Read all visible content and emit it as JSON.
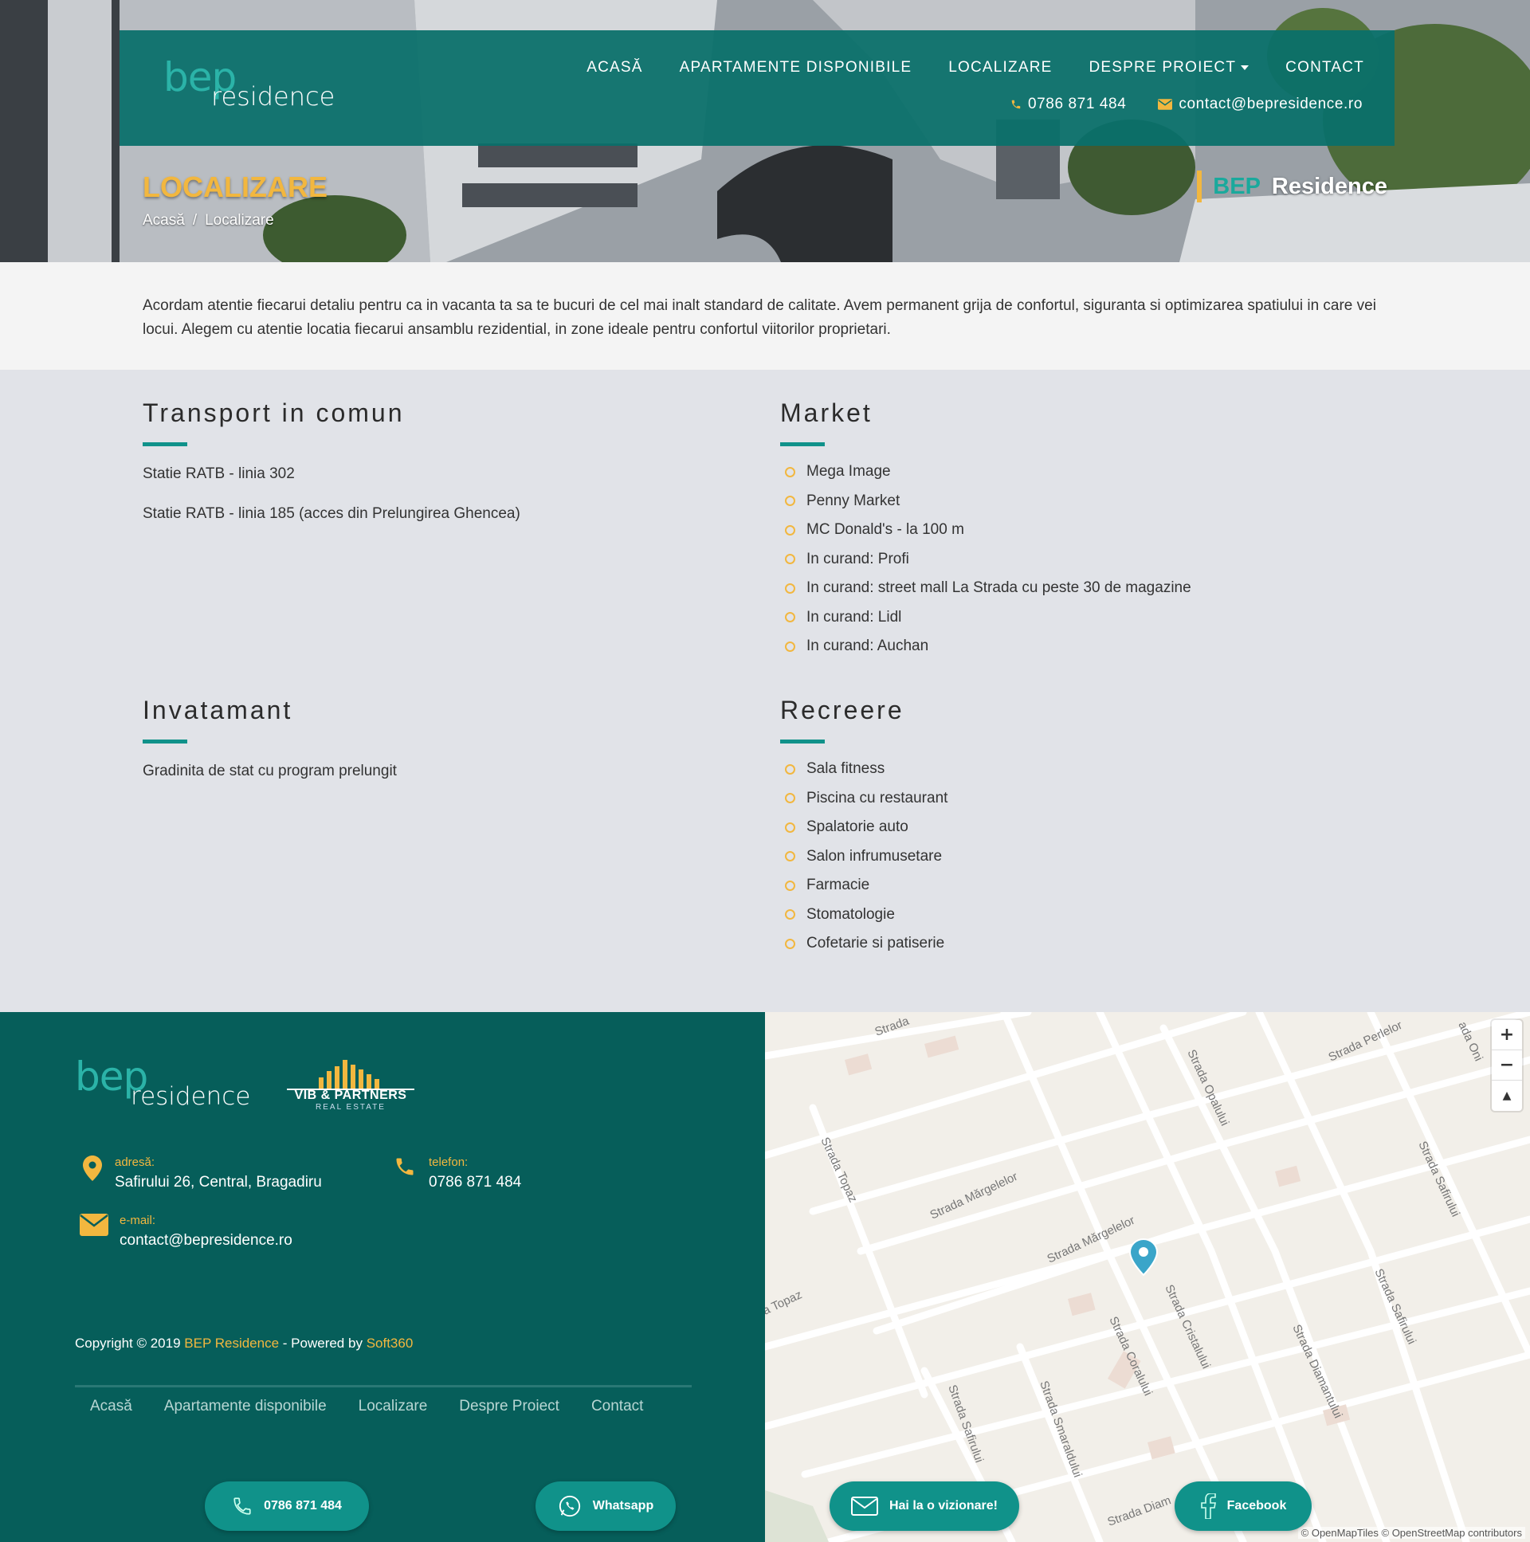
{
  "header": {
    "logo": {
      "part1": "bep",
      "part2": "residence"
    },
    "nav": [
      {
        "label": "ACASĂ"
      },
      {
        "label": "APARTAMENTE DISPONIBILE"
      },
      {
        "label": "LOCALIZARE"
      },
      {
        "label": "DESPRE PROIECT"
      },
      {
        "label": "CONTACT"
      }
    ],
    "phone": "0786 871 484",
    "email": "contact@bepresidence.ro"
  },
  "hero": {
    "title": "LOCALIZARE",
    "breadcrumb": [
      "Acasă",
      "/",
      "Localizare"
    ],
    "brand_a": "BEP",
    "brand_b": "Residence"
  },
  "intro": {
    "text": "Acordam atentie fiecarui detaliu pentru ca in vacanta ta sa te bucuri de cel mai inalt standard de calitate. Avem permanent grija de confortul, siguranta si optimizarea spatiului in care vei locui. Alegem cu atentie locatia fiecarui ansamblu rezidential, in zone ideale pentru confortul viitorilor proprietari."
  },
  "sections": {
    "transport": {
      "title": "Transport in comun",
      "items": [
        "Statie RATB - linia 302",
        "Statie RATB - linia 185 (acces din Prelungirea Ghencea)"
      ]
    },
    "market": {
      "title": "Market",
      "items": [
        "Mega Image",
        "Penny Market",
        "MC Donald's - la 100 m",
        "In curand: Profi",
        "In curand: street mall La Strada cu peste 30 de magazine",
        "In curand: Lidl",
        "In curand: Auchan"
      ]
    },
    "invatamant": {
      "title": "Invatamant",
      "items": [
        "Gradinita de stat cu program prelungit"
      ]
    },
    "recreere": {
      "title": "Recreere",
      "items": [
        "Sala fitness",
        "Piscina cu restaurant",
        "Spalatorie auto",
        "Salon infrumusetare",
        "Farmacie",
        "Stomatologie",
        "Cofetarie si patiserie"
      ]
    }
  },
  "footer": {
    "logo": {
      "part1": "bep",
      "part2": "residence"
    },
    "partner": {
      "name": "VIB & PARTNERS",
      "sub": "REAL ESTATE"
    },
    "address_label": "adresă:",
    "address": "Safirului 26, Central, Bragadiru",
    "phone_label": "telefon:",
    "phone": "0786 871 484",
    "email_label": "e-mail:",
    "email": "contact@bepresidence.ro",
    "copyright_prefix": "Copyright © 2019",
    "copyright_brand": "BEP Residence",
    "copyright_mid": "- Powered by",
    "copyright_powered": "Soft360",
    "links": [
      "Acasă",
      "Apartamente disponibile",
      "Localizare",
      "Despre Proiect",
      "Contact"
    ]
  },
  "floating": {
    "phone": "0786 871 484",
    "whatsapp": "Whatsapp",
    "visit": "Hai la o vizionare!",
    "facebook": "Facebook"
  },
  "map": {
    "streets": [
      "Strada",
      "Strada Perlelor",
      "Strada Opalului",
      "Strada Topaz",
      "Strada Mărgelelor",
      "Strada Mărgelelor",
      "Strada Safirului",
      "Strada Safirului",
      "Strada Cristalului",
      "Strada Coralului",
      "Strada Diamantului",
      "Strada Safirului",
      "Strada Smaraldului",
      "a Topaz",
      "Strada Diam",
      "ada Oni"
    ],
    "attribution": "© OpenMapTiles © OpenStreetMap contributors",
    "zoom_in": "+",
    "zoom_out": "−",
    "compass": "▲"
  },
  "colors": {
    "teal": "#0a706a",
    "teal_dark": "#065e5a",
    "accent": "#f2b73f",
    "button": "#10928a"
  }
}
